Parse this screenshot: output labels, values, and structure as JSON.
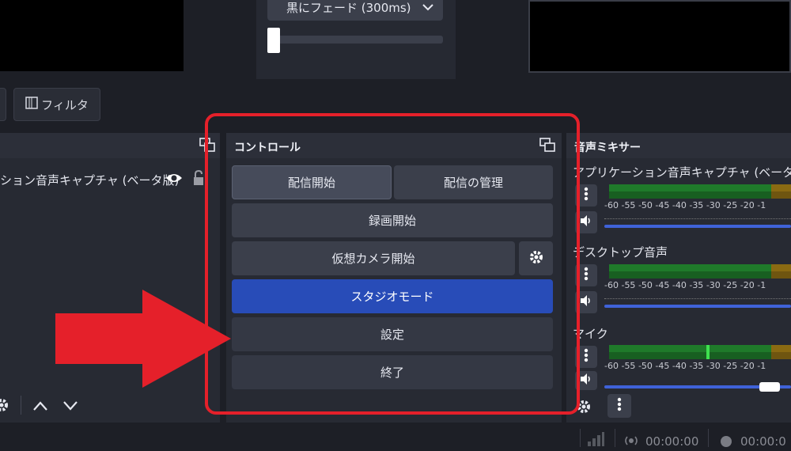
{
  "transition": {
    "selected": "黒にフェード (300ms)"
  },
  "toolbar": {
    "filters_label": "フィルタ"
  },
  "sources": {
    "item_label": "ション音声キャプチャ (ベータ版)"
  },
  "controls": {
    "title": "コントロール",
    "start_streaming": "配信開始",
    "manage_broadcast": "配信の管理",
    "start_recording": "録画開始",
    "start_virtual_camera": "仮想カメラ開始",
    "studio_mode": "スタジオモード",
    "settings": "設定",
    "exit": "終了"
  },
  "mixer": {
    "title": "音声ミキサー",
    "channels": [
      {
        "name": "アプリケーション音声キャプチャ (ベータ版)",
        "volume": 0.95
      },
      {
        "name": "デスクトップ音声",
        "volume": 0.95
      },
      {
        "name": "マイク",
        "volume": 0.85
      }
    ],
    "scale": [
      "-60",
      "-55",
      "-50",
      "-45",
      "-40",
      "-35",
      "-30",
      "-25",
      "-20",
      "-1"
    ]
  },
  "status": {
    "stream_time": "00:00:00",
    "record_time": "00:00:0"
  },
  "colors": {
    "accent_blue": "#284cb8",
    "highlight_red": "#e5202a",
    "meter_green": "#1f7a2a"
  }
}
